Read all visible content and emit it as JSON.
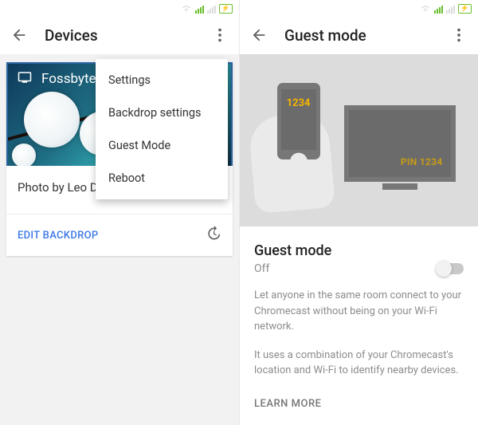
{
  "left": {
    "app_bar": {
      "title": "Devices"
    },
    "device": {
      "name": "Fossbytes",
      "caption": "Photo by Leo Deegan",
      "edit_label": "EDIT BACKDROP"
    },
    "menu": {
      "items": [
        {
          "label": "Settings"
        },
        {
          "label": "Backdrop settings"
        },
        {
          "label": "Guest Mode"
        },
        {
          "label": "Reboot"
        }
      ]
    }
  },
  "right": {
    "app_bar": {
      "title": "Guest mode"
    },
    "hero": {
      "phone_pin": "1234",
      "tv_pin": "PIN 1234"
    },
    "section": {
      "title": "Guest mode",
      "state": "Off",
      "desc1": "Let anyone in the same room connect to your Chromecast without being on your Wi-Fi network.",
      "desc2": "It uses a combination of your Chromecast's location and Wi-Fi to identify nearby devices.",
      "learn_more": "LEARN MORE"
    }
  }
}
